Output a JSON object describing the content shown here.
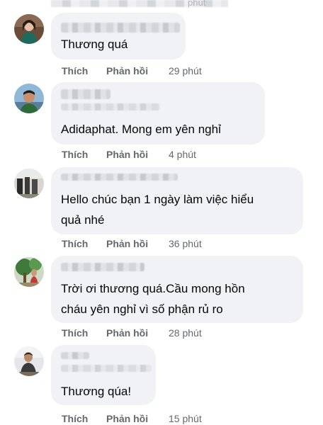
{
  "top_partial": {
    "time": "phút"
  },
  "actions": {
    "like": "Thích",
    "reply": "Phản hồi"
  },
  "comments": [
    {
      "text": "Thương quá",
      "time": "29 phút"
    },
    {
      "text": "Adidaphat. Mong em yên nghỉ",
      "time": "4 phút"
    },
    {
      "text": "Hello chúc bạn 1 ngày làm việc hiểu\nquả nhé",
      "time": "36 phút"
    },
    {
      "text": "Trời ơi thương quá.Cầu mong hồn\ncháu yên nghỉ vì số phận rủ ro",
      "time": "28 phút"
    },
    {
      "text": "Thương qúa!",
      "time": "15 phút"
    }
  ],
  "colors": {
    "bubble": "#f0f2f5",
    "text": "#050505",
    "meta": "#65676b"
  }
}
